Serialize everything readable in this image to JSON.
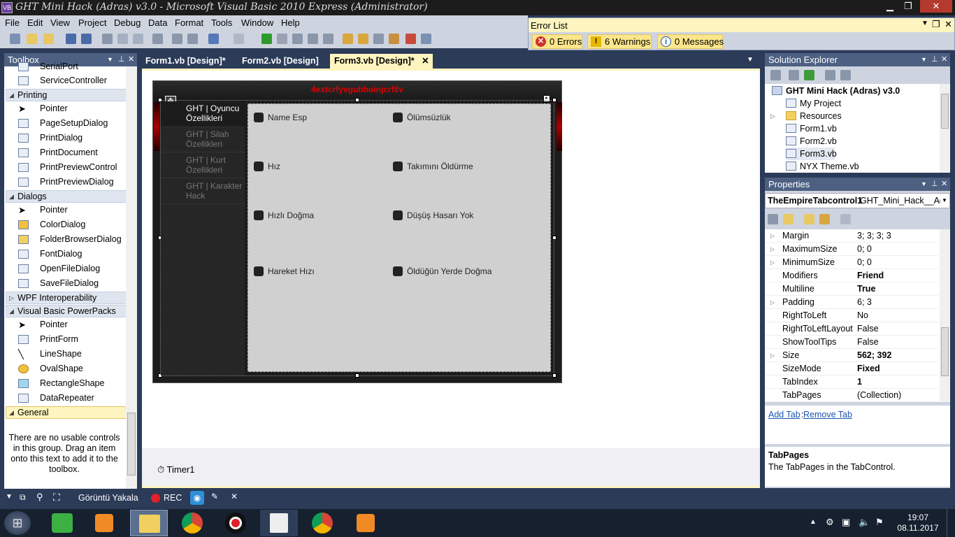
{
  "window": {
    "title": "GHT Mini Hack (Adras) v3.0 - Microsoft Visual Basic 2010 Express (Administrator)"
  },
  "menu": [
    "File",
    "Edit",
    "View",
    "Project",
    "Debug",
    "Data",
    "Format",
    "Tools",
    "Window",
    "Help"
  ],
  "error_list": {
    "title": "Error List",
    "errors": "0 Errors",
    "warnings": "6 Warnings",
    "messages": "0 Messages"
  },
  "toolbox": {
    "title": "Toolbox",
    "top_items": [
      "SerialPort",
      "ServiceController"
    ],
    "groups": [
      {
        "name": "Printing",
        "items": [
          "Pointer",
          "PageSetupDialog",
          "PrintDialog",
          "PrintDocument",
          "PrintPreviewControl",
          "PrintPreviewDialog"
        ]
      },
      {
        "name": "Dialogs",
        "items": [
          "Pointer",
          "ColorDialog",
          "FolderBrowserDialog",
          "FontDialog",
          "OpenFileDialog",
          "SaveFileDialog"
        ]
      },
      {
        "name": "WPF Interoperability",
        "items": []
      },
      {
        "name": "Visual Basic PowerPacks",
        "items": [
          "Pointer",
          "PrintForm",
          "LineShape",
          "OvalShape",
          "RectangleShape",
          "DataRepeater"
        ]
      },
      {
        "name": "General",
        "items": []
      }
    ],
    "empty_msg": "There are no usable controls in this group. Drag an item onto this text to add it to the toolbox."
  },
  "doc_tabs": [
    "Form1.vb [Design]*",
    "Form2.vb [Design]",
    "Form3.vb [Design]*"
  ],
  "form": {
    "title": "4extcrfyvgubhoinjcrf8v",
    "tabs": [
      "GHT | Oyuncu Özellikleri",
      "GHT | Silah Özellikleri",
      "GHT | Kurt Özellikleri",
      "GHT | Karakter Hack"
    ],
    "checkboxes_left": [
      "Name Esp",
      "Hız",
      "Hızlı Doğma",
      "Hareket Hızı"
    ],
    "checkboxes_right": [
      "Ölümsüzlük",
      "Takımını Öldürme",
      "Düşüş Hasarı Yok",
      "Öldüğün Yerde Doğma"
    ]
  },
  "tray": {
    "component": "Timer1"
  },
  "solution_explorer": {
    "title": "Solution Explorer",
    "items": [
      "GHT Mini Hack (Adras) v3.0",
      "My Project",
      "Resources",
      "Form1.vb",
      "Form2.vb",
      "Form3.vb",
      "NYX Theme.vb"
    ]
  },
  "properties": {
    "title": "Properties",
    "object": "TheEmpireTabcontrol1",
    "object_type": "GHT_Mini_Hack__Adr",
    "rows": [
      {
        "name": "Margin",
        "value": "3; 3; 3; 3"
      },
      {
        "name": "MaximumSize",
        "value": "0; 0"
      },
      {
        "name": "MinimumSize",
        "value": "0; 0"
      },
      {
        "name": "Modifiers",
        "value": "Friend"
      },
      {
        "name": "Multiline",
        "value": "True"
      },
      {
        "name": "Padding",
        "value": "6; 3"
      },
      {
        "name": "RightToLeft",
        "value": "No"
      },
      {
        "name": "RightToLeftLayout",
        "value": "False"
      },
      {
        "name": "ShowToolTips",
        "value": "False"
      },
      {
        "name": "Size",
        "value": "562; 392"
      },
      {
        "name": "SizeMode",
        "value": "Fixed"
      },
      {
        "name": "TabIndex",
        "value": "1"
      },
      {
        "name": "TabPages",
        "value": "(Collection)"
      }
    ],
    "add_tab": "Add Tab",
    "remove_tab": "Remove Tab",
    "desc_title": "TabPages",
    "desc_text": "The TabPages in the TabControl."
  },
  "recorder": {
    "capture": "Görüntü Yakala",
    "rec": "REC"
  },
  "clock": {
    "time": "19:07",
    "date": "08.11.2017"
  }
}
